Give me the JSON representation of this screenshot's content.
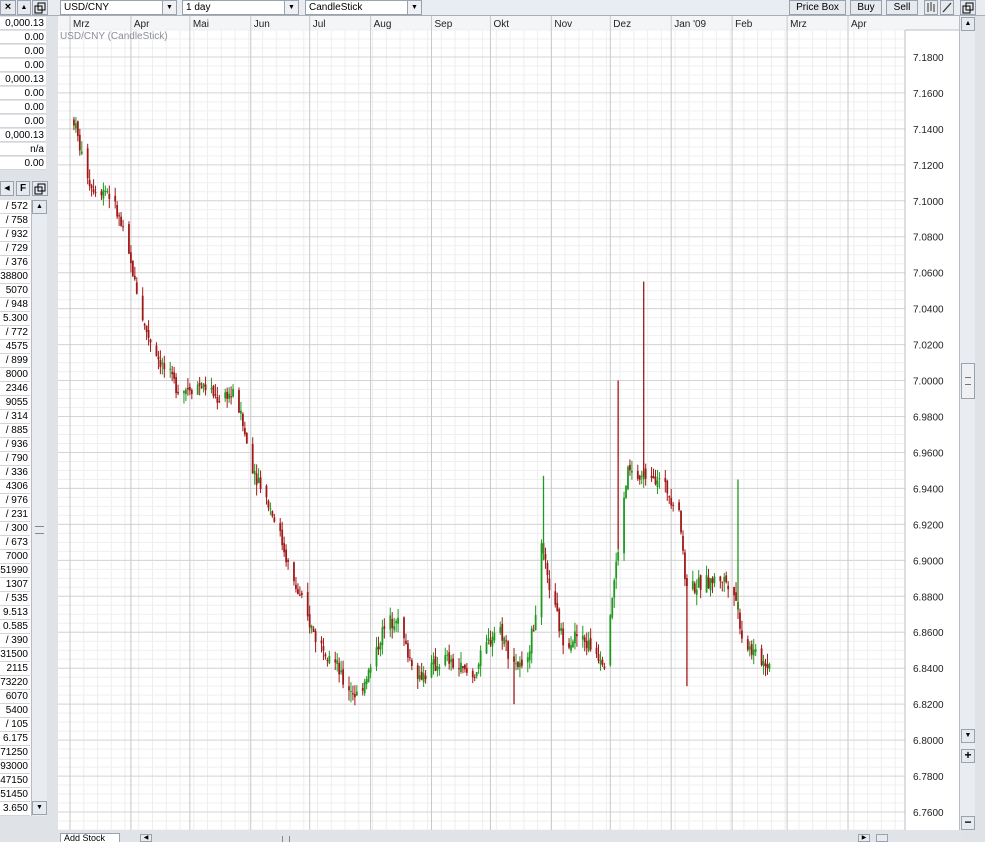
{
  "toolbar": {
    "symbol": "USD/CNY",
    "interval": "1 day",
    "chart_type": "CandleStick",
    "price_box_label": "Price Box",
    "buy_label": "Buy",
    "sell_label": "Sell"
  },
  "details_values": [
    "0,000.13",
    "0.00",
    "0.00",
    "0.00",
    "0,000.13",
    "0.00",
    "0.00",
    "0.00",
    "0,000.13",
    "n/a",
    "0.00"
  ],
  "watchlist_values": [
    "/ 572",
    "/ 758",
    "/ 932",
    "/ 729",
    "/ 376",
    "38800",
    "5070",
    "/ 948",
    "5.300",
    "/ 772",
    "4575",
    "/ 899",
    "8000",
    "2346",
    "9055",
    "/ 314",
    "/ 885",
    "/ 936",
    "/ 790",
    "/ 336",
    "4306",
    "/ 976",
    "/ 231",
    "/ 300",
    "/ 673",
    "7000",
    "51990",
    "1307",
    "/ 535",
    "9.513",
    "0.585",
    "/ 390",
    "31500",
    "2115",
    "73220",
    "6070",
    "5400",
    "/ 105",
    "6.175",
    "71250",
    "93000",
    "47150",
    "51450",
    "3.650"
  ],
  "watchlist_letter": "F",
  "bottom_tab": "Add Stock",
  "chart_title": "USD/CNY (CandleStick)",
  "chart_data": {
    "type": "candlestick",
    "title": "USD/CNY (CandleStick)",
    "x_month_labels": [
      "Mrz",
      "Apr",
      "Mai",
      "Jun",
      "Jul",
      "Aug",
      "Sep",
      "Okt",
      "Nov",
      "Dez",
      "Jan '09",
      "Feb",
      "Mrz",
      "Apr"
    ],
    "y_tick_labels": [
      "7.1800",
      "7.1600",
      "7.1400",
      "7.1200",
      "7.1000",
      "7.0800",
      "7.0600",
      "7.0400",
      "7.0200",
      "7.0000",
      "6.9800",
      "6.9600",
      "6.9400",
      "6.9200",
      "6.9000",
      "6.8800",
      "6.8600",
      "6.8400",
      "6.8200",
      "6.8000",
      "6.7800",
      "6.7600"
    ],
    "ylim": [
      6.75,
      7.195
    ],
    "grid": true,
    "colors": {
      "up": "#1f9a1f",
      "down": "#a01818",
      "grid": "#d5d5d5",
      "axis_text": "#222222"
    },
    "x_month_starts": [
      "2008-03-01",
      "2008-04-01",
      "2008-05-01",
      "2008-06-01",
      "2008-07-01",
      "2008-08-01",
      "2008-09-01",
      "2008-10-01",
      "2008-11-01",
      "2008-12-01",
      "2009-01-01",
      "2009-02-01",
      "2009-03-01",
      "2009-04-01"
    ],
    "x_end": "2009-04-30",
    "trend_points": [
      [
        "2008-03-03",
        7.145
      ],
      [
        "2008-03-07",
        7.125
      ],
      [
        "2008-03-12",
        7.108
      ],
      [
        "2008-03-20",
        7.106
      ],
      [
        "2008-03-26",
        7.09
      ],
      [
        "2008-04-02",
        7.06
      ],
      [
        "2008-04-08",
        7.03
      ],
      [
        "2008-04-14",
        7.015
      ],
      [
        "2008-04-20",
        7.002
      ],
      [
        "2008-04-27",
        6.995
      ],
      [
        "2008-05-04",
        6.998
      ],
      [
        "2008-05-10",
        6.996
      ],
      [
        "2008-05-15",
        6.99
      ],
      [
        "2008-05-20",
        6.993
      ],
      [
        "2008-05-25",
        6.99
      ],
      [
        "2008-06-01",
        6.955
      ],
      [
        "2008-06-07",
        6.94
      ],
      [
        "2008-06-15",
        6.918
      ],
      [
        "2008-06-22",
        6.89
      ],
      [
        "2008-06-29",
        6.87
      ],
      [
        "2008-07-05",
        6.855
      ],
      [
        "2008-07-12",
        6.848
      ],
      [
        "2008-07-18",
        6.832
      ],
      [
        "2008-07-25",
        6.825
      ],
      [
        "2008-08-01",
        6.84
      ],
      [
        "2008-08-07",
        6.86
      ],
      [
        "2008-08-14",
        6.87
      ],
      [
        "2008-08-20",
        6.848
      ],
      [
        "2008-08-26",
        6.835
      ],
      [
        "2008-09-01",
        6.84
      ],
      [
        "2008-09-08",
        6.845
      ],
      [
        "2008-09-15",
        6.84
      ],
      [
        "2008-09-22",
        6.835
      ],
      [
        "2008-09-28",
        6.85
      ],
      [
        "2008-10-05",
        6.865
      ],
      [
        "2008-10-10",
        6.85
      ],
      [
        "2008-10-17",
        6.838
      ],
      [
        "2008-10-23",
        6.862
      ],
      [
        "2008-10-27",
        6.905
      ],
      [
        "2008-11-01",
        6.88
      ],
      [
        "2008-11-07",
        6.855
      ],
      [
        "2008-11-14",
        6.858
      ],
      [
        "2008-11-21",
        6.852
      ],
      [
        "2008-11-28",
        6.845
      ],
      [
        "2008-12-02",
        6.88
      ],
      [
        "2008-12-06",
        6.915
      ],
      [
        "2008-12-10",
        6.95
      ],
      [
        "2008-12-16",
        6.945
      ],
      [
        "2008-12-22",
        6.95
      ],
      [
        "2008-12-29",
        6.94
      ],
      [
        "2009-01-05",
        6.93
      ],
      [
        "2009-01-08",
        6.89
      ],
      [
        "2009-01-14",
        6.885
      ],
      [
        "2009-01-20",
        6.888
      ],
      [
        "2009-01-27",
        6.89
      ],
      [
        "2009-02-02",
        6.885
      ],
      [
        "2009-02-06",
        6.858
      ],
      [
        "2009-02-12",
        6.848
      ],
      [
        "2009-02-18",
        6.843
      ],
      [
        "2009-02-20",
        6.843
      ]
    ],
    "spikes": [
      [
        "2008-12-05",
        7.0,
        "down"
      ],
      [
        "2008-12-18",
        7.055,
        "down"
      ],
      [
        "2008-10-28",
        6.947,
        "up"
      ],
      [
        "2009-02-04",
        6.945,
        "up"
      ],
      [
        "2009-01-09",
        6.83,
        "down"
      ],
      [
        "2008-10-13",
        6.82,
        "down"
      ]
    ]
  }
}
